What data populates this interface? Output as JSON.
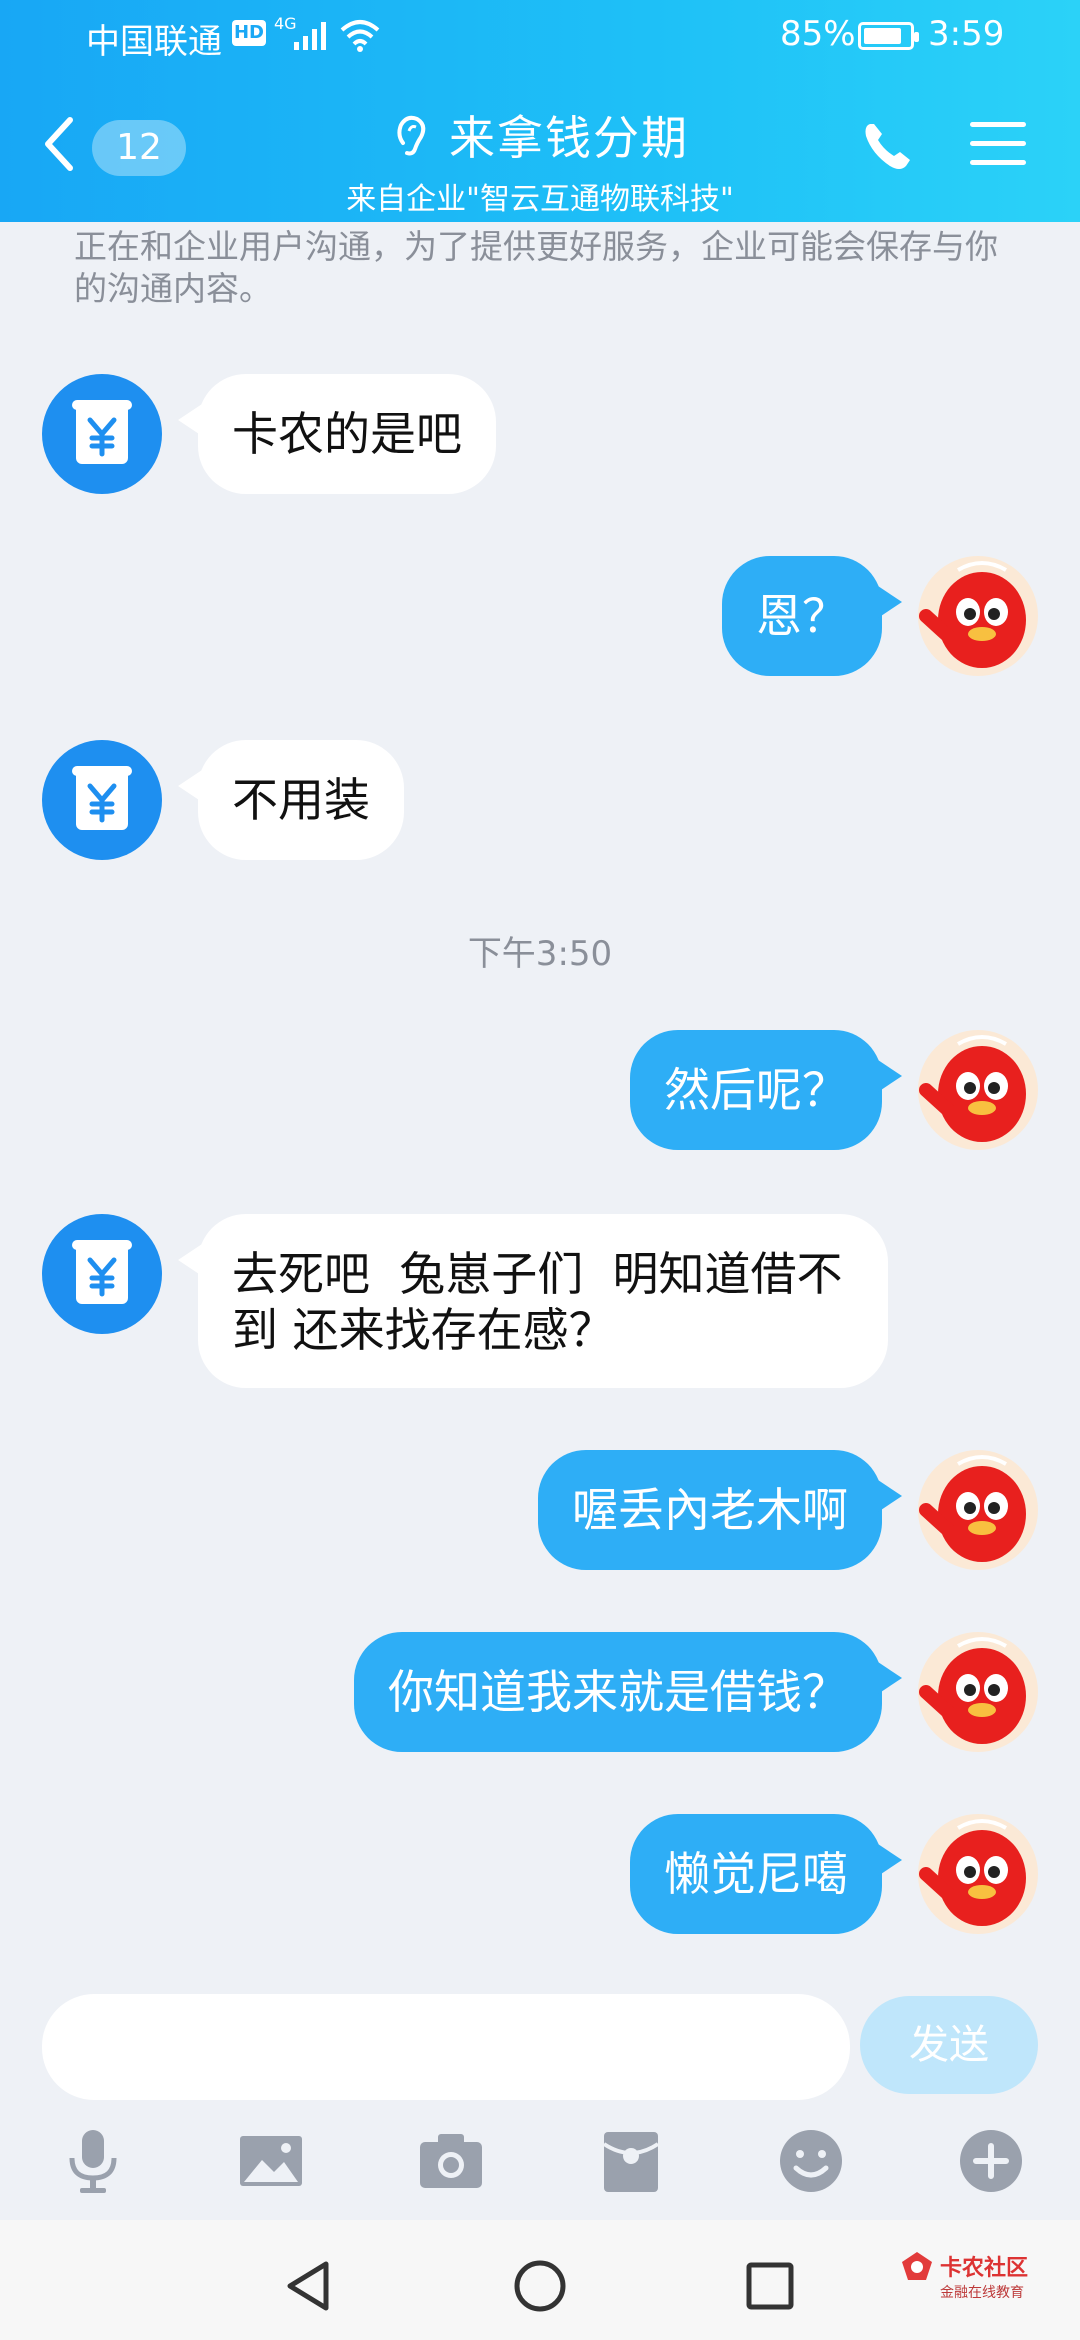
{
  "status_bar": {
    "carrier": "中国联通",
    "hd": "HD",
    "network": "4G",
    "battery_pct": "85%",
    "battery_level": 0.85,
    "time": "3:59"
  },
  "nav": {
    "unread_count": "12",
    "title": "来拿钱分期",
    "subtitle": "来自企业\"智云互通物联科技\""
  },
  "notice": "正在和企业用户沟通，为了提供更好服务，企业可能会保存与你的沟通内容。",
  "messages": [
    {
      "side": "in",
      "text": "卡农的是吧"
    },
    {
      "side": "out",
      "text": "恩？"
    },
    {
      "side": "in",
      "text": "不用装"
    },
    {
      "side": "out",
      "text": "然后呢？"
    },
    {
      "side": "in",
      "text": "去死吧  兔崽子们  明知道借不到 还来找存在感？"
    },
    {
      "side": "out",
      "text": "喔丢內老木啊"
    },
    {
      "side": "out",
      "text": "你知道我来就是借钱？"
    },
    {
      "side": "out",
      "text": "懒觉尼噶"
    }
  ],
  "timestamp": "下午3:50",
  "input": {
    "placeholder": "",
    "send_label": "发送"
  },
  "toolbar_icons": [
    "mic-icon",
    "image-icon",
    "camera-icon",
    "red-packet-icon",
    "emoji-icon",
    "plus-icon"
  ],
  "watermark": {
    "line1": "卡农社区",
    "line2": "金融在线教育"
  },
  "colors": {
    "header_start": "#18a7f5",
    "header_end": "#2bd2f8",
    "out_bubble": "#2eaef6",
    "in_bubble": "#ffffff",
    "send_disabled": "#bfe6fb",
    "background": "#eef1f6"
  }
}
